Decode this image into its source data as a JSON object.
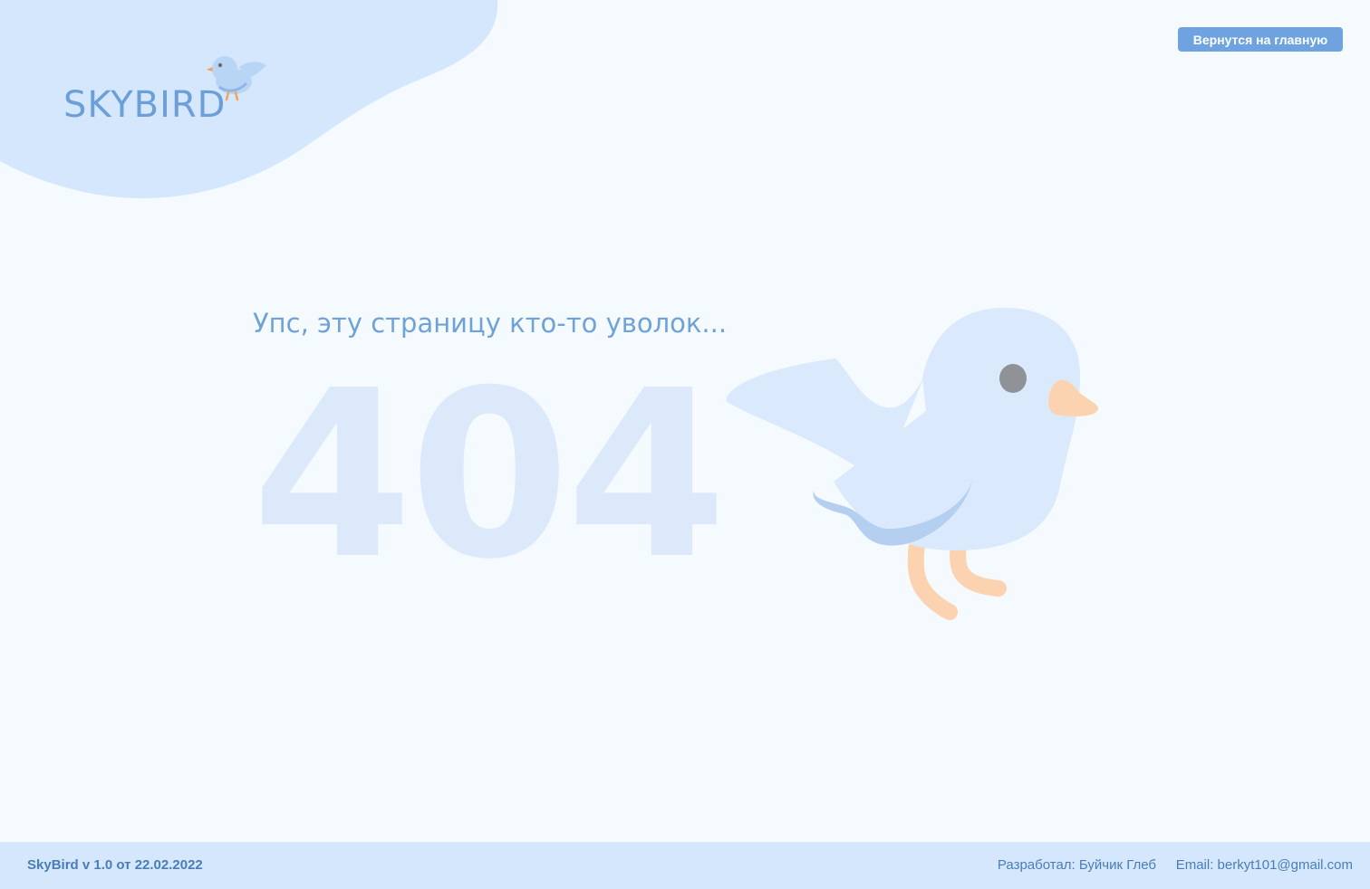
{
  "header": {
    "logo_text": "SKYBIRD",
    "home_button_label": "Вернутся на главную"
  },
  "main": {
    "message": "Упс, эту страницу кто-то уволок...",
    "error_code": "404"
  },
  "footer": {
    "version": "SkyBird v 1.0 от 22.02.2022",
    "author": "Разработал: Буйчик Глеб",
    "email": "Email: berkyt101@gmail.com"
  },
  "icons": {
    "logo": "bird-logo-icon",
    "illustration": "bird-illustration"
  },
  "colors": {
    "page_background": "#f5faff",
    "blob": "#d4e7fd",
    "accent": "#6fa3df",
    "error_code": "#dbe9fb",
    "footer_background": "#d4e7fd",
    "footer_text": "#4a7db8"
  }
}
